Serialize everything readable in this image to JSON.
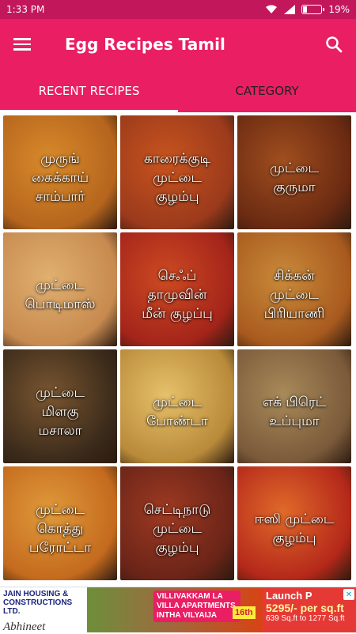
{
  "status_bar": {
    "time": "1:33 PM",
    "battery": "19%"
  },
  "app_bar": {
    "title": "Egg Recipes Tamil"
  },
  "tabs": [
    {
      "label": "RECENT RECIPES",
      "active": true
    },
    {
      "label": "CATEGORY",
      "active": false
    }
  ],
  "recipes": [
    {
      "label": "முருங்\nகைக்காய்\nசாம்பார்",
      "color1": "#b5651d",
      "color2": "#d88a2a"
    },
    {
      "label": "காரைக்குடி\nமுட்டை\nகுழம்பு",
      "color1": "#9b3a1c",
      "color2": "#c8541e"
    },
    {
      "label": "முட்டை\nகுருமா",
      "color1": "#6a2a12",
      "color2": "#a04e1e"
    },
    {
      "label": "முட்டை\nபொடிமாஸ்",
      "color1": "#c78a4f",
      "color2": "#e0b070"
    },
    {
      "label": "செஃப்\nதாமுவின்\nமீன் குழப்பு",
      "color1": "#a4241a",
      "color2": "#cd4a22"
    },
    {
      "label": "சிக்கன்\nமுட்டை\nபிரியாணி",
      "color1": "#a85a1e",
      "color2": "#c98a3a"
    },
    {
      "label": "முட்டை\nமிளகு\nமசாலா",
      "color1": "#3a2a1a",
      "color2": "#7a5630"
    },
    {
      "label": "முட்டை\nபோண்டா",
      "color1": "#b88a3a",
      "color2": "#e6c06a"
    },
    {
      "label": "எக் பிரெட்\nஉப்புமா",
      "color1": "#7a5a3a",
      "color2": "#a88a5a"
    },
    {
      "label": "முட்டை\nகொத்து\nபரோட்டா",
      "color1": "#c46a1e",
      "color2": "#e09a3a"
    },
    {
      "label": "செட்டிநாடு\nமுட்டை\nகுழம்பு",
      "color1": "#6a2418",
      "color2": "#9e3a22"
    },
    {
      "label": "ஈஸி முட்டை\nகுழம்பு",
      "color1": "#b4281a",
      "color2": "#e06a2a"
    }
  ],
  "ad": {
    "left_brand": "JAIN HOUSING & CONSTRUCTIONS LTD.",
    "left_sub": "Abhineet",
    "promo": "VILLIVAKKAM LA VILLA APARTMENTS INTHA VILYAIJA",
    "date": "16th",
    "launch": "Launch P",
    "price": "5295/- per sq.ft",
    "range": "639 Sq.ft to 1277 Sq.ft"
  },
  "icons": {
    "menu": "hamburger-menu-icon",
    "search": "search-icon",
    "wifi": "wifi-icon",
    "signal": "signal-icon",
    "battery": "battery-icon"
  },
  "colors": {
    "primary": "#e91e63",
    "status_bar": "#c2185b"
  }
}
